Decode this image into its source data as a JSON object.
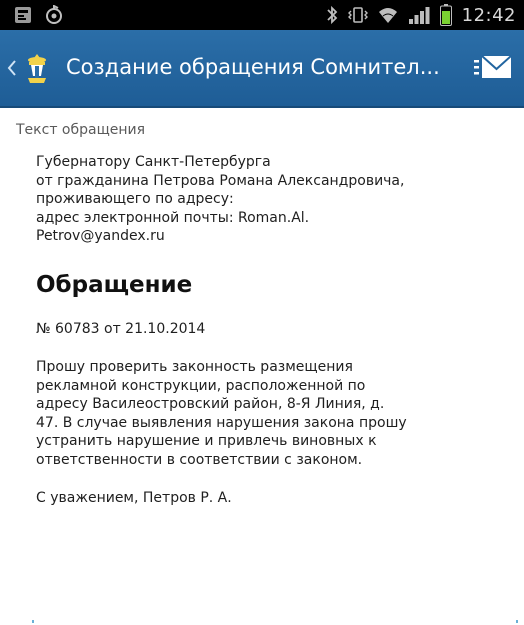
{
  "status_bar": {
    "time": "12:42",
    "icons": [
      "notification-icon",
      "app-icon",
      "bluetooth-icon",
      "vibrate-icon",
      "wifi-icon",
      "signal-icon",
      "battery-icon"
    ],
    "battery_color": "#7bd132"
  },
  "action_bar": {
    "title": "Создание обращения Сомнител...",
    "background": "#2265a0",
    "logo_icon": "city-emblem-icon",
    "action_icon": "mail-send-icon"
  },
  "content": {
    "section_label": "Текст обращения",
    "address_lines": [
      "Губернатору Санкт-Петербурга",
      "от гражданина Петрова Романа Александровича,",
      "проживающего по адресу:",
      "адрес электронной почты: Roman.Al.",
      "Petrov@yandex.ru"
    ],
    "heading": "Обращение",
    "number_line": "№ 60783 от 21.10.2014",
    "body_lines": [
      "Прошу проверить законность размещения",
      "рекламной конструкции, расположенной по",
      "адресу Василеостровский район, 8-Я Линия, д.",
      "47. В случае выявления нарушения закона прошу",
      "устранить нарушение и привлечь виновных к",
      "ответственности в соответствии с законом."
    ],
    "signature": "С уважением, Петров Р. А."
  }
}
